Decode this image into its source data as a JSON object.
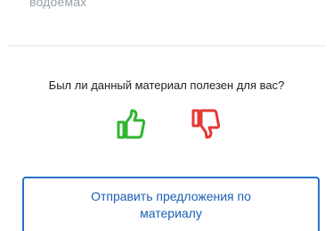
{
  "previous_section": {
    "trailing_text": "водоемах"
  },
  "feedback": {
    "question": "Был ли данный материал полезен для вас?",
    "like_icon": "thumbs-up-icon",
    "dislike_icon": "thumbs-down-icon",
    "like_color": "#2fb52f",
    "dislike_color": "#e53935"
  },
  "suggest": {
    "button_label": "Отправить предложения по материалу",
    "color": "#2a71c9"
  }
}
